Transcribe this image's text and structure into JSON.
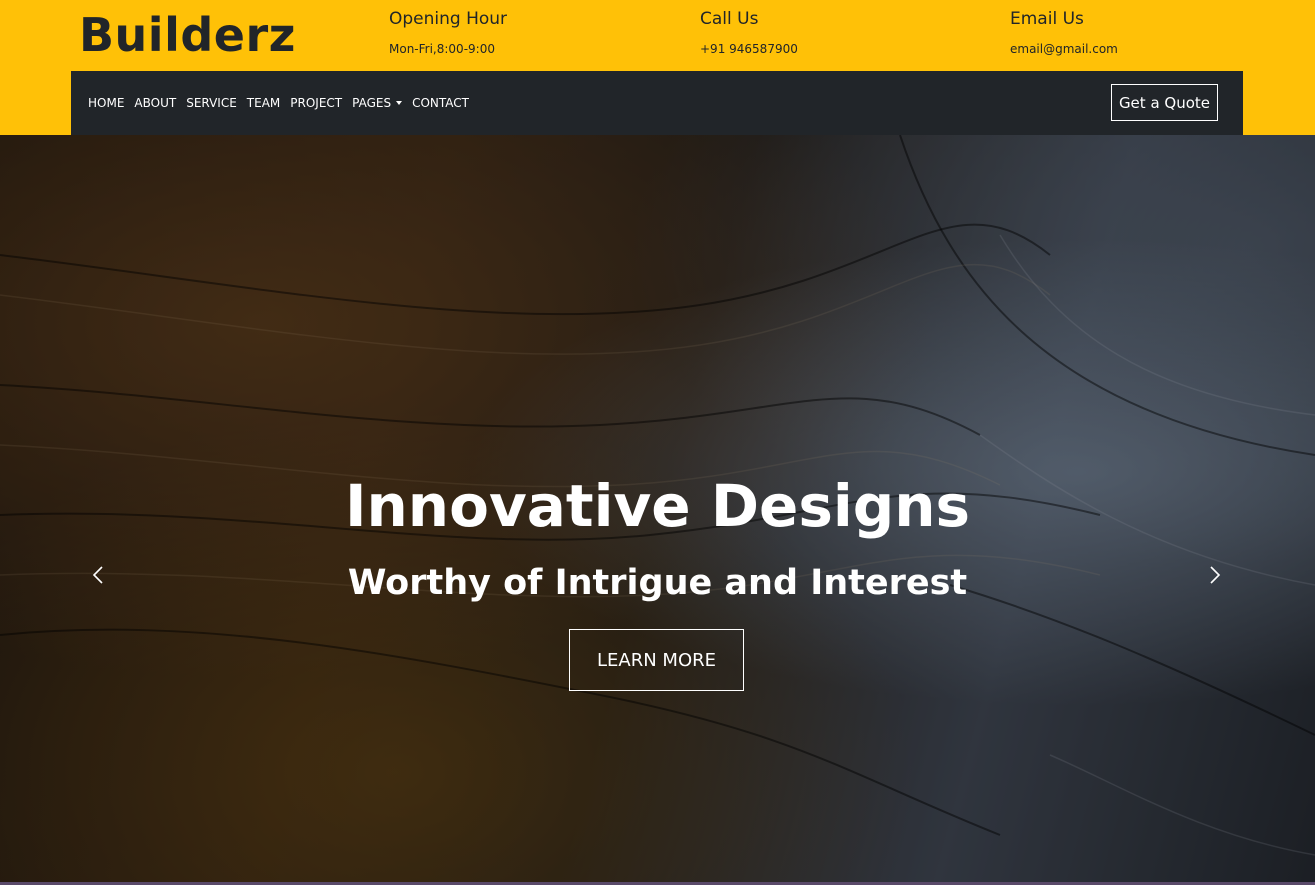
{
  "brand": {
    "name": "Builderz"
  },
  "header_info": {
    "opening": {
      "title": "Opening Hour",
      "value": "Mon-Fri,8:00-9:00"
    },
    "call": {
      "title": "Call Us",
      "value": "+91 946587900"
    },
    "email": {
      "title": "Email Us",
      "value": "email@gmail.com"
    }
  },
  "nav": {
    "items": [
      "HOME",
      "ABOUT",
      "SERVICE",
      "TEAM",
      "PROJECT",
      "PAGES",
      "CONTACT"
    ],
    "quote_label": "Get a Quote"
  },
  "hero": {
    "title": "Innovative Designs",
    "subtitle": "Worthy of Intrigue and Interest",
    "button_label": "LEARN MORE",
    "prev_icon": "chevron-left-icon",
    "next_icon": "chevron-right-icon"
  },
  "colors": {
    "accent": "#FFC107",
    "nav_bg": "#212529",
    "text_light": "#FFFFFF"
  }
}
